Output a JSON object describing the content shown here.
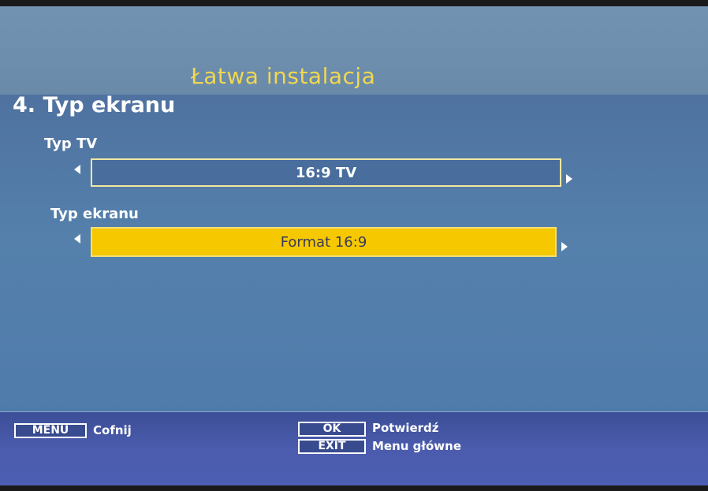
{
  "header": {
    "title": "Łatwa instalacja"
  },
  "section": {
    "title": "4. Typ ekranu"
  },
  "fields": [
    {
      "label": "Typ TV",
      "value": "16:9 TV",
      "selected": false
    },
    {
      "label": "Typ ekranu",
      "value": "Format 16:9",
      "selected": true
    }
  ],
  "footer": {
    "menu_key": "MENU",
    "menu_desc": "Cofnij",
    "ok_key": "OK",
    "ok_desc": "Potwierdź",
    "exit_key": "EXIT",
    "exit_desc": "Menu główne"
  },
  "icons": {
    "prev": "triangle-left-icon",
    "next": "triangle-right-icon"
  },
  "colors": {
    "title": "#f0d850",
    "highlight": "#f6c800",
    "footer": "#4b5cae"
  }
}
